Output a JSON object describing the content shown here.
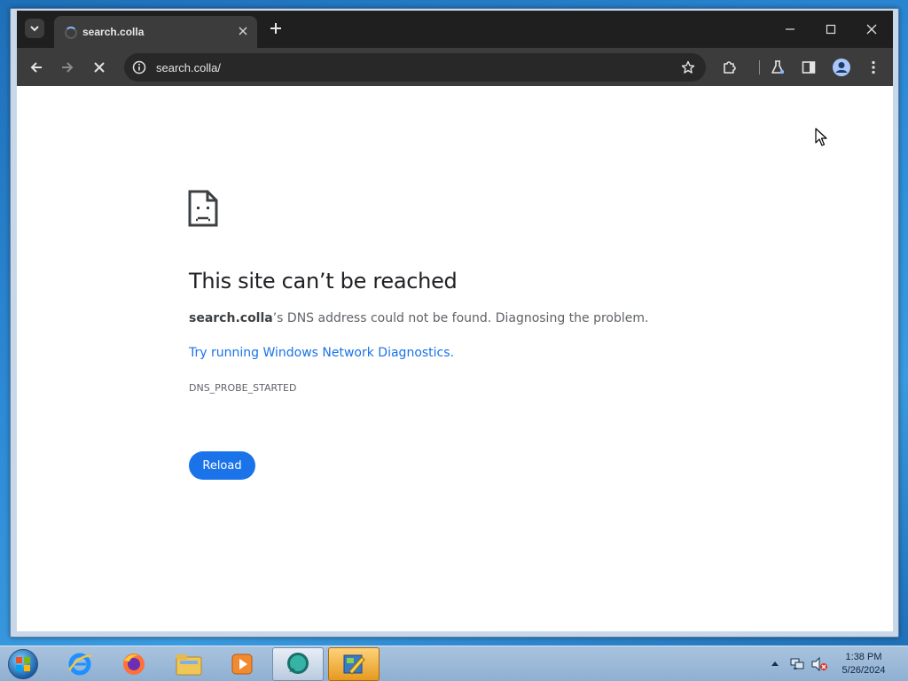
{
  "tab": {
    "title": "search.colla"
  },
  "address_bar": {
    "url": "search.colla/"
  },
  "error": {
    "title": "This site can’t be reached",
    "host": "search.colla",
    "message_rest": "’s DNS address could not be found. Diagnosing the problem.",
    "link_text": "Try running Windows Network Diagnostics.",
    "code": "DNS_PROBE_STARTED",
    "reload_label": "Reload"
  },
  "taskbar": {
    "apps": [
      "internet-explorer",
      "firefox",
      "file-explorer",
      "media-player",
      "chat-app",
      "paint-app"
    ],
    "clock_time": "1:38 PM",
    "clock_date": "5/26/2024"
  },
  "colors": {
    "accent": "#1a73e8",
    "titlebar": "#1f1f1f",
    "toolbar": "#3c3c3c"
  }
}
